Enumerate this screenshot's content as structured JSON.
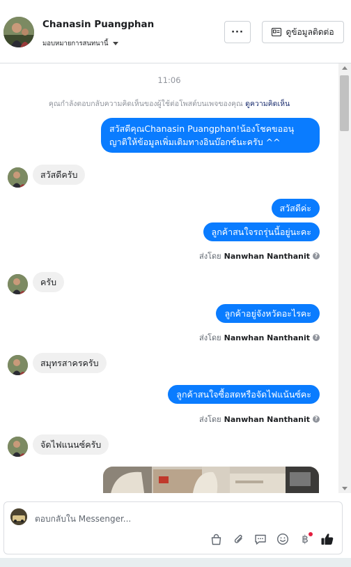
{
  "header": {
    "contact_name": "Chanasin Puangphan",
    "assign_label": "มอบหมายการสนทนานี้",
    "more_label": "···",
    "contact_info_label": "ดูข้อมูลติดต่อ"
  },
  "chat": {
    "timestamp": "11:06",
    "notice_text": "คุณกำลังตอบกลับความคิดเห็นของผู้ใช้ต่อโพสต์บนเพจของคุณ",
    "notice_link": "ดูความคิดเห็น",
    "messages": [
      {
        "dir": "out",
        "line1": "สวัสดีคุณChanasin Puangphan!น้องโชคขออนุ",
        "line2": "ญาติให้ข้อมูลเพิ่มเติมทางอินบ๊อกซ์นะครับ ^^"
      },
      {
        "dir": "in",
        "text": "สวัสดีครับ"
      },
      {
        "dir": "out",
        "text": "สวัสดีค่ะ"
      },
      {
        "dir": "out",
        "text": "ลูกค้าสนใจรถรุ่นนี้อยู่นะคะ"
      },
      {
        "dir": "in",
        "text": "ครับ"
      },
      {
        "dir": "out",
        "text": "ลูกค้าอยู่จังหวัดอะไรคะ"
      },
      {
        "dir": "in",
        "text": "สมุทรสาครครับ"
      },
      {
        "dir": "out",
        "text": "ลูกค้าสนใจซื้อสดหรือจัดไฟแน้นซ์คะ"
      },
      {
        "dir": "in",
        "text": "จัดไฟแนนซ์ครับ"
      }
    ],
    "sent_by_prefix": "ส่งโดย",
    "sent_by_name": "Nanwhan Nanthanit"
  },
  "composer": {
    "placeholder": "ตอบกลับใน Messenger..."
  },
  "icons": [
    "shopping-bag-icon",
    "paperclip-icon",
    "saved-reply-icon",
    "emoji-icon",
    "baht-payment-icon",
    "thumbs-up-icon"
  ],
  "colors": {
    "outgoing_bubble": "#0a7cff",
    "incoming_bubble": "#f0f0f0",
    "like": "#1c1e21",
    "notification_dot": "#e41e3f"
  }
}
